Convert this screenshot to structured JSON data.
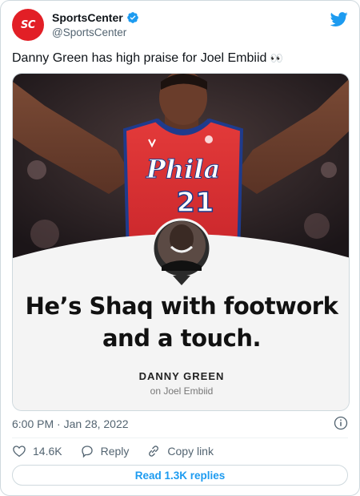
{
  "account": {
    "display_name": "SportsCenter",
    "handle": "@SportsCenter",
    "avatar_text": "SC"
  },
  "tweet": {
    "text": "Danny Green has high praise for Joel Embiid",
    "emoji": "👀"
  },
  "media": {
    "jersey_text": "Phila",
    "jersey_number": "21",
    "quote": "He’s Shaq with footwork\nand a touch.",
    "attribution_name": "DANNY GREEN",
    "attribution_sub": "on Joel Embiid"
  },
  "meta": {
    "timestamp": "6:00 PM · Jan 28, 2022"
  },
  "actions": {
    "likes": "14.6K",
    "reply": "Reply",
    "copy_link": "Copy link"
  },
  "read_replies": "Read 1.3K replies",
  "colors": {
    "accent": "#1d9bf0",
    "brand_red": "#e21f26",
    "jersey_red": "#e02b2f"
  }
}
